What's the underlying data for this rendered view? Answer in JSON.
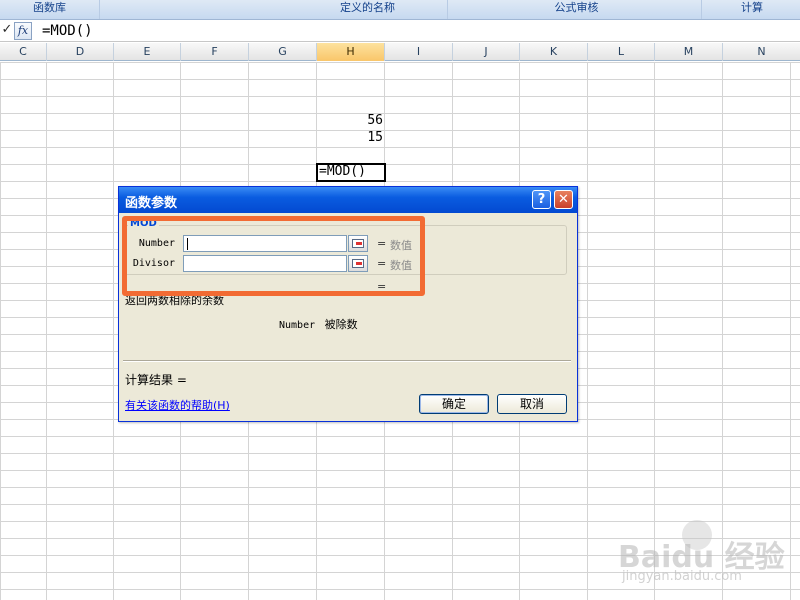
{
  "ribbon": {
    "groups": [
      "函数库",
      "定义的名称",
      "公式审核",
      "计算"
    ]
  },
  "formula_bar": {
    "check": "✓",
    "fx": "fx",
    "formula": "=MOD()"
  },
  "columns": [
    "C",
    "D",
    "E",
    "F",
    "G",
    "H",
    "I",
    "J",
    "K",
    "L",
    "M",
    "N"
  ],
  "active_column": "H",
  "cells": {
    "h1": "56",
    "h2": "15",
    "active": "=MOD()"
  },
  "dialog": {
    "title": "函数参数",
    "help_button": "?",
    "close_button": "✕",
    "function_name": "MOD",
    "args": [
      {
        "label": "Number",
        "value": "",
        "equals": "=",
        "result": "数值"
      },
      {
        "label": "Divisor",
        "value": "",
        "equals": "=",
        "result": "数值"
      }
    ],
    "equals_summary": "=",
    "description": "返回两数相除的余数",
    "arg_description_name": "Number",
    "arg_description_text": "被除数",
    "result_label": "计算结果 =",
    "help_link": "有关该函数的帮助(H)",
    "ok_button": "确定",
    "cancel_button": "取消"
  },
  "watermark": {
    "text": "Baidu 经验",
    "sub": "jingyan.baidu.com"
  },
  "colors": {
    "highlight": "#f26b33",
    "titlebar": "#0a5ce0",
    "active_column": "#f9c66a"
  }
}
